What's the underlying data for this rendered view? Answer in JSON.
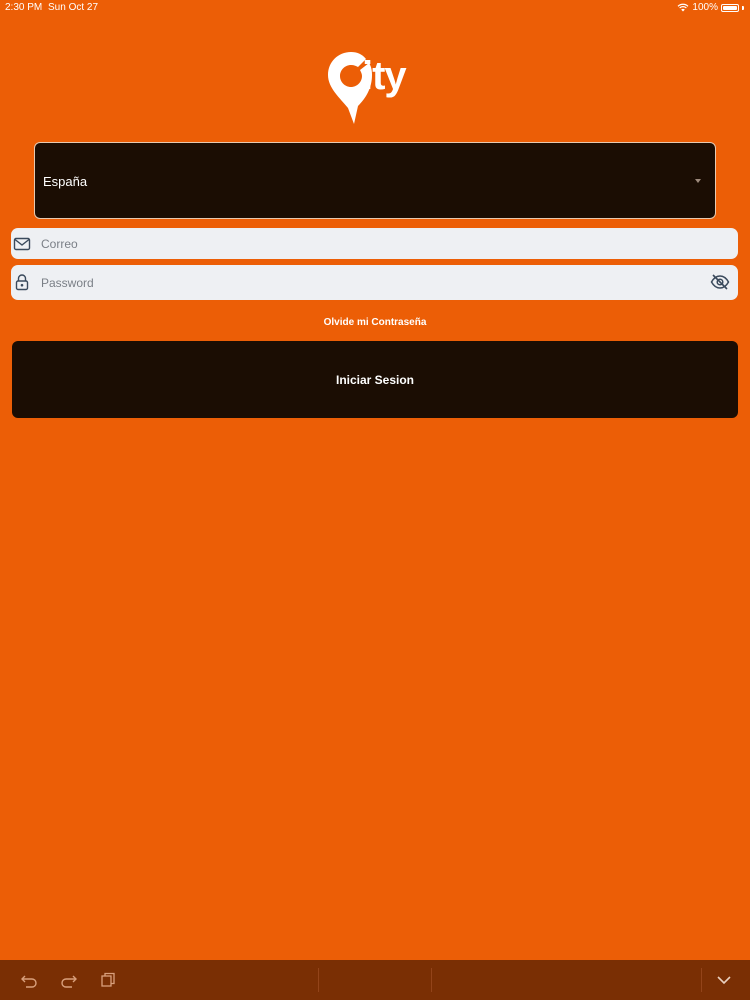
{
  "status_bar": {
    "time": "2:30 PM",
    "date": "Sun Oct 27",
    "battery": "100%"
  },
  "logo": {
    "text": "ity"
  },
  "country": {
    "selected": "España"
  },
  "email": {
    "placeholder": "Correo",
    "value": ""
  },
  "password": {
    "placeholder": "Password",
    "value": ""
  },
  "forgot_password_label": "Olvide mi Contraseña",
  "login_label": "Iniciar Sesion",
  "colors": {
    "background": "#ec5e06",
    "dark": "#1b0d03",
    "field": "#eef0f3"
  }
}
